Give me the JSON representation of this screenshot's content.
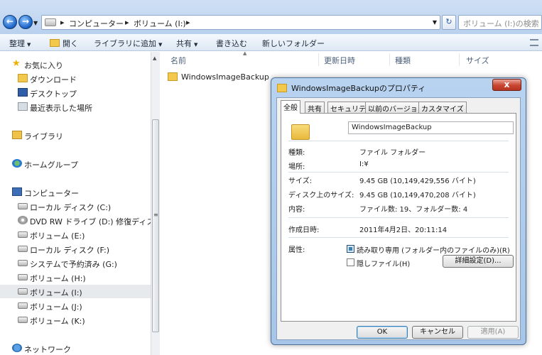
{
  "address": {
    "crumbs": [
      "コンピューター",
      "ボリューム (I:)"
    ],
    "search_placeholder": "ボリューム (I:)の検索"
  },
  "toolbar": {
    "organize": "整理",
    "open": "開く",
    "add_to_library": "ライブラリに追加",
    "share": "共有",
    "burn": "書き込む",
    "new_folder": "新しいフォルダー"
  },
  "nav": {
    "favorites": "お気に入り",
    "downloads": "ダウンロード",
    "desktop": "デスクトップ",
    "recent": "最近表示した場所",
    "libraries": "ライブラリ",
    "homegroup": "ホームグループ",
    "computer": "コンピューター",
    "drive_c": "ローカル ディスク (C:)",
    "drive_d": "DVD RW ドライブ (D:) 修復ディスク",
    "drive_e": "ボリューム (E:)",
    "drive_f": "ローカル ディスク (F:)",
    "drive_g": "システムで予約済み (G:)",
    "drive_h": "ボリューム (H:)",
    "drive_i": "ボリューム (I:)",
    "drive_j": "ボリューム (J:)",
    "drive_k": "ボリューム (K:)",
    "network": "ネットワーク"
  },
  "columns": {
    "name": "名前",
    "modified": "更新日時",
    "type": "種類",
    "size": "サイズ"
  },
  "files": [
    {
      "name": "WindowsImageBackup"
    }
  ],
  "dialog": {
    "title": "WindowsImageBackupのプロパティ",
    "close": "x",
    "tabs": [
      "全般",
      "共有",
      "セキュリティ",
      "以前のバージョン",
      "カスタマイズ"
    ],
    "folder_name": "WindowsImageBackup",
    "type_label": "種類:",
    "type_value": "ファイル フォルダー",
    "location_label": "場所:",
    "location_value": "I:¥",
    "size_label": "サイズ:",
    "size_value": "9.45 GB (10,149,429,556 バイト)",
    "disk_size_label": "ディスク上のサイズ:",
    "disk_size_value": "9.45 GB (10,149,470,208 バイト)",
    "contains_label": "内容:",
    "contains_value": "ファイル数: 19、フォルダー数: 4",
    "created_label": "作成日時:",
    "created_value": "2011年4月2日、20:11:14",
    "attributes_label": "属性:",
    "readonly_label": "読み取り専用 (フォルダー内のファイルのみ)(R)",
    "hidden_label": "隠しファイル(H)",
    "advanced": "詳細設定(D)...",
    "ok": "OK",
    "cancel": "キャンセル",
    "apply": "適用(A)"
  }
}
